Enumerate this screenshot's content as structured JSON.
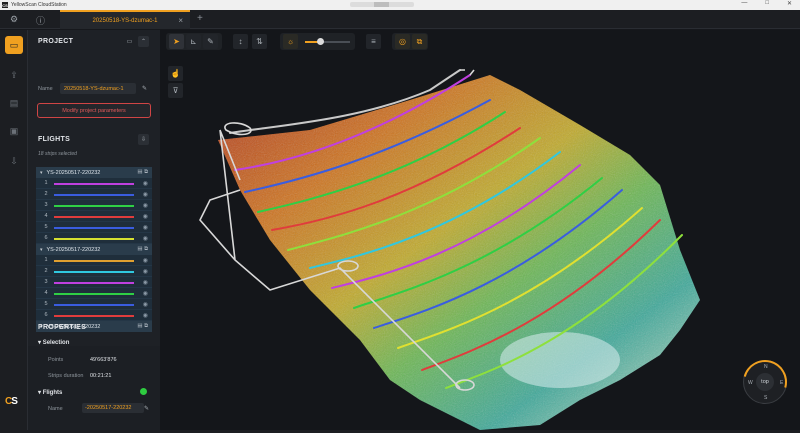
{
  "window": {
    "title": "YellowScan CloudStation",
    "app_icon": "CS",
    "controls": [
      "—",
      "□",
      "✕"
    ]
  },
  "tabs": {
    "active_label": "20250518-YS-dzumac-1",
    "close_glyph": "×",
    "add_glyph": "+"
  },
  "project": {
    "title": "PROJECT",
    "name_label": "Name",
    "name_value": "20250518-YS-dzumac-1",
    "modify_label": "Modify project parameters"
  },
  "flights": {
    "title": "FLIGHTS",
    "selection_note": "18 strips selected",
    "groups": [
      {
        "name": "YS-20250517-220232",
        "strips": [
          {
            "num": "1",
            "color": "#c040e0"
          },
          {
            "num": "2",
            "color": "#3a5de0"
          },
          {
            "num": "3",
            "color": "#2fcf45"
          },
          {
            "num": "4",
            "color": "#e03c3c"
          },
          {
            "num": "5",
            "color": "#3a5de0"
          },
          {
            "num": "6",
            "color": "#d6e030"
          }
        ]
      },
      {
        "name": "YS-20250517-220232",
        "strips": [
          {
            "num": "1",
            "color": "#e0a030"
          },
          {
            "num": "2",
            "color": "#30c8e0"
          },
          {
            "num": "3",
            "color": "#c040e0"
          },
          {
            "num": "4",
            "color": "#2fcf45"
          },
          {
            "num": "5",
            "color": "#3a5de0"
          },
          {
            "num": "6",
            "color": "#e03c3c"
          }
        ]
      },
      {
        "name": "YS-20250517-220232",
        "strips": []
      }
    ]
  },
  "properties": {
    "title": "PROPERTIES",
    "selection_label": "Selection",
    "points_label": "Points",
    "points_value": "49'663'876",
    "duration_label": "Strips duration",
    "duration_value": "00:21:21",
    "flights_label": "Flights",
    "flight_name_label": "Name",
    "flight_name_value": "-20250517-220232"
  },
  "compass": {
    "center_label": "top",
    "letters": [
      "N",
      "W",
      "S",
      "E"
    ]
  },
  "logo": {
    "text_a": "C",
    "text_b": "S"
  },
  "colors": {
    "accent": "#f0a020",
    "panel": "#1e2126",
    "selected_row": "#2a3c4b"
  },
  "icons": [
    "settings-icon",
    "info-icon",
    "folder-icon",
    "pointer-icon",
    "measure-icon",
    "pen-icon",
    "sun-icon",
    "layers-icon"
  ]
}
